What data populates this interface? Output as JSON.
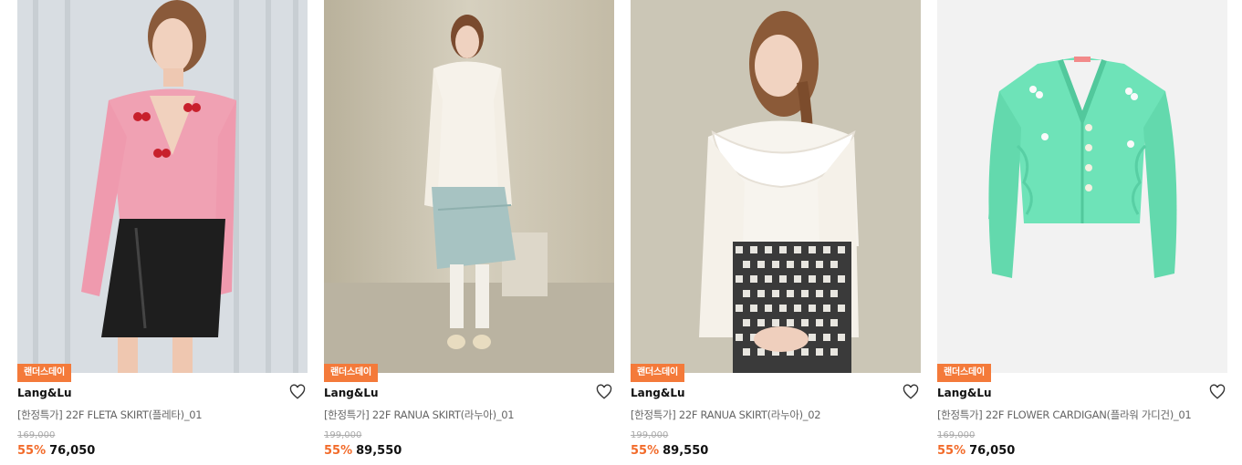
{
  "products": [
    {
      "badge": "랜더스데이",
      "brand": "Lang&Lu",
      "name": "[한정특가] 22F FLETA SKIRT(플레타)_01",
      "original_price": "169,000",
      "discount": "55%",
      "sale_price": "76,050",
      "image": "model-pink-cherry-cardigan-black-leather-skirt"
    },
    {
      "badge": "랜더스데이",
      "brand": "Lang&Lu",
      "name": "[한정특가] 22F RANUA SKIRT(라누아)_01",
      "original_price": "199,000",
      "discount": "55%",
      "sale_price": "89,550",
      "image": "model-white-turtleneck-mint-tweed-skirt"
    },
    {
      "badge": "랜더스데이",
      "brand": "Lang&Lu",
      "name": "[한정특가] 22F RANUA SKIRT(라누아)_02",
      "original_price": "199,000",
      "discount": "55%",
      "sale_price": "89,550",
      "image": "model-white-ruffle-blouse-houndstooth-skirt"
    },
    {
      "badge": "랜더스데이",
      "brand": "Lang&Lu",
      "name": "[한정특가] 22F FLOWER CARDIGAN(플라워 가디건)_01",
      "original_price": "169,000",
      "discount": "55%",
      "sale_price": "76,050",
      "image": "mint-flower-cardigan-product-shot"
    }
  ],
  "icons": {
    "wishlist": "heart-outline-icon"
  },
  "colors": {
    "badge": "#f47a3a",
    "discount": "#f26b2a"
  }
}
